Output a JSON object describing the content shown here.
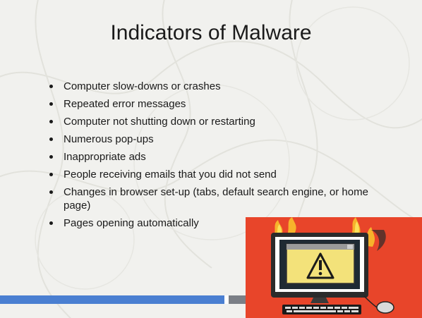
{
  "slide": {
    "title": "Indicators of Malware",
    "bullets": [
      "Computer slow-downs or crashes",
      "Repeated error messages",
      "Computer not shutting down or restarting",
      "Numerous pop-ups",
      "Inappropriate ads",
      "People receiving emails that you did not send",
      "Changes in browser set-up (tabs,  default search engine, or home page)",
      "Pages opening automatically"
    ]
  },
  "colors": {
    "background": "#f1f1ee",
    "footer_blue": "#4a7fd1",
    "footer_gray": "#7b7f86",
    "illustration_red": "#e8452a"
  },
  "illustration": {
    "icon": "burning-computer-warning-icon"
  }
}
